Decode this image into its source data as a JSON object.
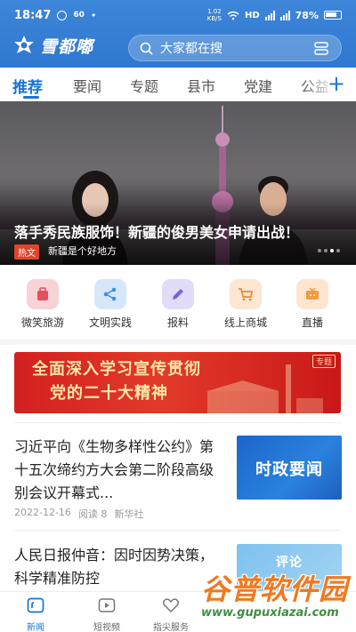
{
  "status_bar": {
    "time": "18:47",
    "speed_value": "1.02",
    "speed_unit": "KB/S",
    "network": "HD",
    "battery": "78%"
  },
  "header": {
    "app_name": "雪都嘟",
    "search_placeholder": "大家都在搜",
    "accent_color": "#2f78cf"
  },
  "tabs": [
    {
      "label": "推荐",
      "active": true
    },
    {
      "label": "要闻"
    },
    {
      "label": "专题"
    },
    {
      "label": "县市"
    },
    {
      "label": "党建"
    },
    {
      "label": "公益"
    }
  ],
  "add_tab_icon": "plus-icon",
  "banner": {
    "title": "落手秀民族服饰！新疆的俊男美女申请出战！",
    "tag": "热文",
    "subtitle": "新疆是个好地方"
  },
  "quick_entries": [
    {
      "label": "微笑旅游",
      "icon": "luggage-icon",
      "color": "#f7d2d6"
    },
    {
      "label": "文明实践",
      "icon": "share-icon",
      "color": "#d6e7fa"
    },
    {
      "label": "报料",
      "icon": "pen-icon",
      "color": "#e2dcf8"
    },
    {
      "label": "线上商城",
      "icon": "cart-icon",
      "color": "#fde6d2"
    },
    {
      "label": "直播",
      "icon": "tv-icon",
      "color": "#fde5cf"
    }
  ],
  "promo": {
    "line1": "全面深入学习宣传贯彻",
    "line2": "党的二十大精神",
    "tag": "专题"
  },
  "news": [
    {
      "title": "习近平向《生物多样性公约》第十五次缔约方大会第二阶段高级别会议开幕式...",
      "date": "2022-12-16",
      "reads": "阅读 8",
      "source": "新华社",
      "thumb_title": "时政要闻"
    },
    {
      "title": "人民日报仲音：因时因势决策，科学精准防控",
      "thumb_title": "评论"
    }
  ],
  "bottom_nav": [
    {
      "label": "新闻",
      "icon": "news-icon",
      "active": true
    },
    {
      "label": "短视频",
      "icon": "video-icon"
    },
    {
      "label": "指尖服务",
      "icon": "heart-icon"
    }
  ],
  "watermark": {
    "text": "谷普软件园",
    "url": "www.gupuxiazai.com"
  }
}
